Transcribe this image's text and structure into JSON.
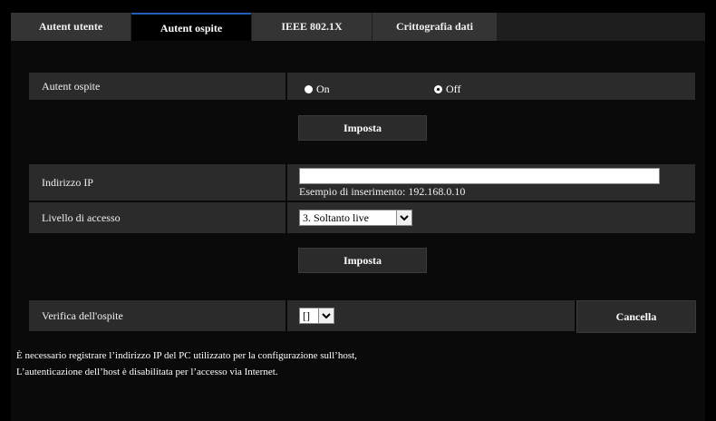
{
  "tabs": [
    {
      "label": "Autent utente",
      "active": false
    },
    {
      "label": "Autent ospite",
      "active": true
    },
    {
      "label": "IEEE 802.1X",
      "active": false
    },
    {
      "label": "Crittografia dati",
      "active": false
    }
  ],
  "guest_auth": {
    "label": "Autent ospite",
    "on_label": "On",
    "off_label": "Off",
    "selected": "Off"
  },
  "set_button_1": "Imposta",
  "ip_address": {
    "label": "Indirizzo IP",
    "value": "",
    "hint": "Esempio di inserimento: 192.168.0.10"
  },
  "access_level": {
    "label": "Livello di accesso",
    "selected": "3. Soltanto live"
  },
  "set_button_2": "Imposta",
  "guest_check": {
    "label": "Verifica dell'ospite",
    "selected": "[]",
    "delete_label": "Cancella"
  },
  "notes": [
    "È necessario registrare l’indirizzo IP del PC utilizzato per la configurazione sull’host,",
    "L’autenticazione dell’host è disabilitata per l’accesso via Internet."
  ],
  "colors": {
    "background": "#000000",
    "row": "#2b2b2b",
    "tab": "#343434",
    "active_tab_accent": "#1f5fb8"
  }
}
